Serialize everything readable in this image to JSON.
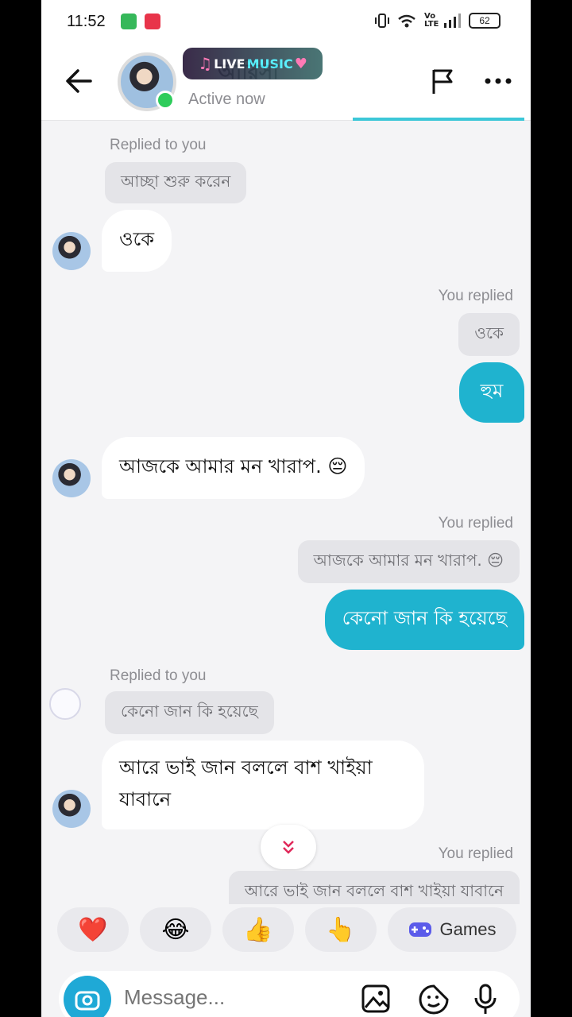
{
  "status_bar": {
    "time": "11:52",
    "battery": "62",
    "network_label": "Vo LTE"
  },
  "header": {
    "contact_name": "আরিসা",
    "status": "Active now",
    "sticker_text_a": "LIVE",
    "sticker_text_b": "MUSIC"
  },
  "messages": {
    "m1_label": "Replied to you",
    "m1_quote": "আচ্ছা শুরু করেন",
    "m1_text": "ওকে",
    "m2_label": "You replied",
    "m2_quote": "ওকে",
    "m2_text": "হুম",
    "m3_text": "আজকে আমার মন খারাপ. 😔",
    "m4_label": "You replied",
    "m4_quote": "আজকে আমার মন খারাপ. 😔",
    "m4_text": "কেনো জান কি হয়েছে",
    "m5_label": "Replied to you",
    "m5_quote": "কেনো জান কি হয়েছে",
    "m5_text_line1": "আরে ভাই জান বললে বাশ খাইয়া",
    "m5_text_line2": "যাবানে",
    "m6_label": "You replied",
    "m6_quote": "আরে ভাই জান বললে বাশ খাইয়া যাবানে"
  },
  "quick_replies": {
    "heart": "❤️",
    "laugh": "😂",
    "thumbs": "👍",
    "point": "👆",
    "games": "Games"
  },
  "composer": {
    "placeholder": "Message..."
  },
  "colors": {
    "accent": "#1fb3cf",
    "online": "#2ecc5b"
  }
}
